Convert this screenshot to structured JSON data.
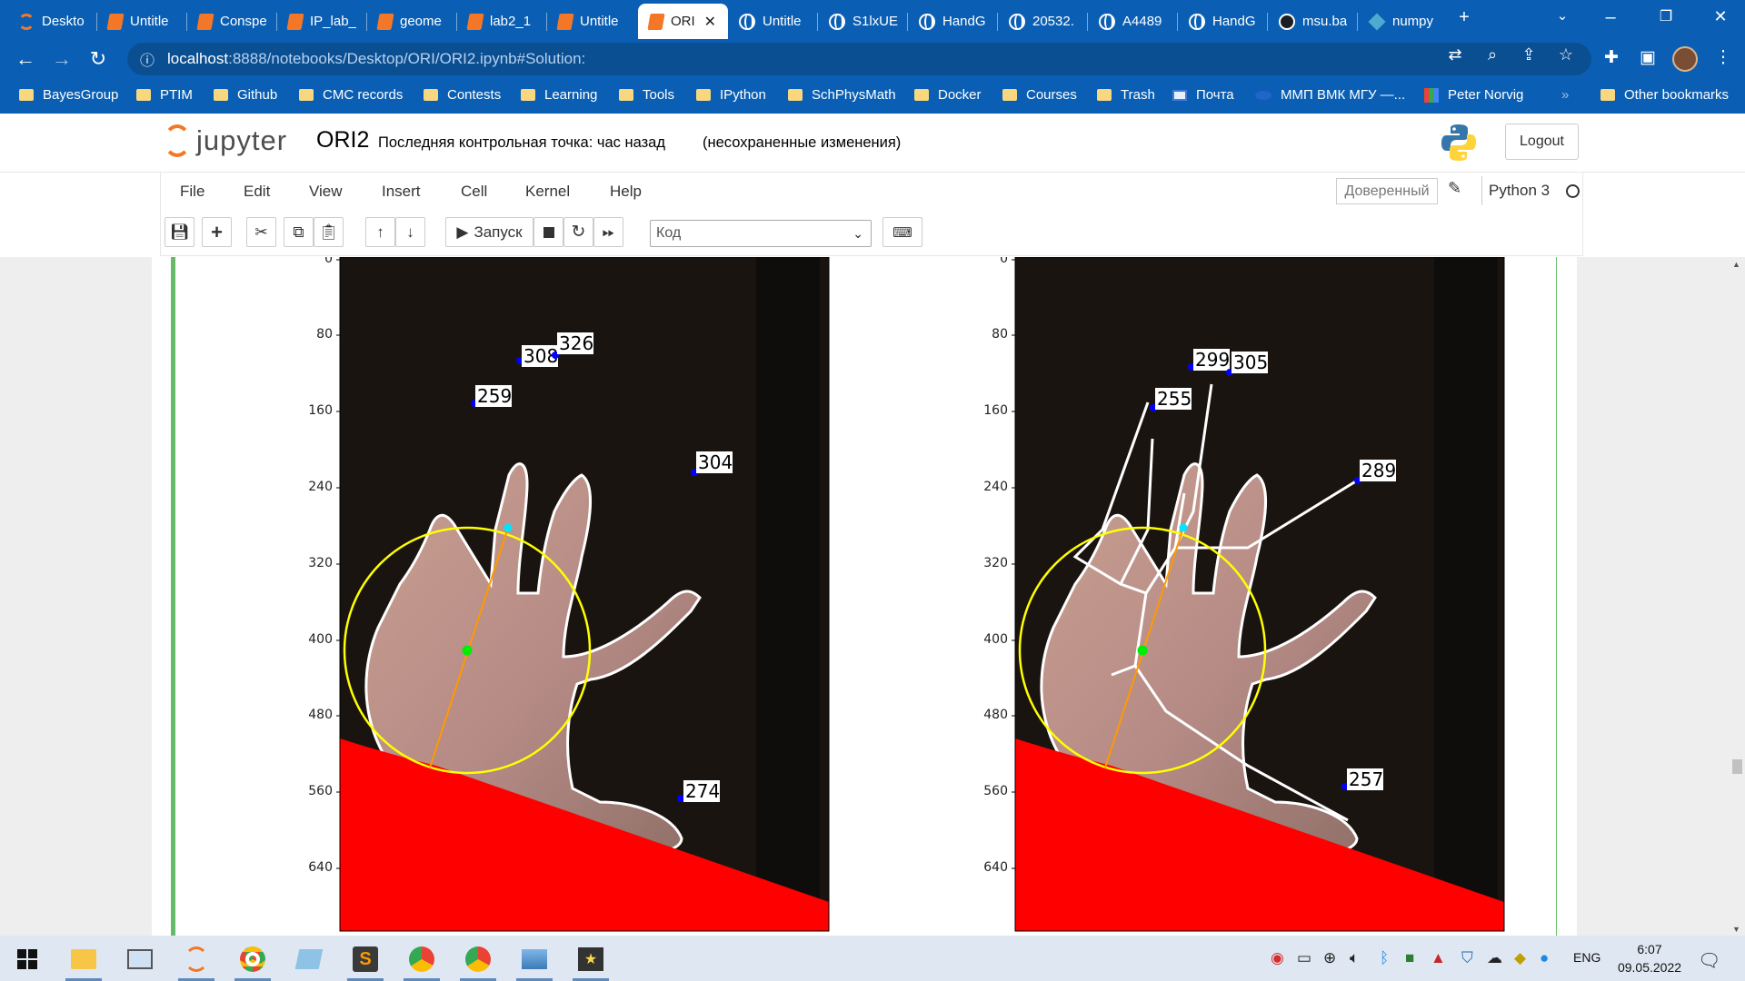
{
  "tabs": [
    {
      "title": "Deskto",
      "icon": "jupyter-icon"
    },
    {
      "title": "Untitle",
      "icon": "notebook-icon"
    },
    {
      "title": "Conspe",
      "icon": "notebook-icon"
    },
    {
      "title": "IP_lab_",
      "icon": "notebook-icon"
    },
    {
      "title": "geome",
      "icon": "notebook-icon"
    },
    {
      "title": "lab2_1",
      "icon": "notebook-icon"
    },
    {
      "title": "Untitle",
      "icon": "notebook-icon"
    },
    {
      "title": "ORI",
      "icon": "notebook-icon",
      "active": true
    },
    {
      "title": "Untitle",
      "icon": "globe-icon"
    },
    {
      "title": "S1lxUE",
      "icon": "globe-icon"
    },
    {
      "title": "HandG",
      "icon": "globe-icon"
    },
    {
      "title": "20532.",
      "icon": "globe-icon"
    },
    {
      "title": "A4489",
      "icon": "globe-icon"
    },
    {
      "title": "HandG",
      "icon": "globe-icon"
    },
    {
      "title": "msu.ba",
      "icon": "github-icon"
    },
    {
      "title": "numpy",
      "icon": "numpy-icon"
    }
  ],
  "address": {
    "host": "localhost",
    "path": ":8888/notebooks/Desktop/ORI/ORI2.ipynb#Solution:"
  },
  "bookmarks": [
    {
      "label": "BayesGroup",
      "icon": "folder-icon"
    },
    {
      "label": "PTIM",
      "icon": "folder-icon"
    },
    {
      "label": "Github",
      "icon": "folder-icon"
    },
    {
      "label": "CMC records",
      "icon": "folder-icon"
    },
    {
      "label": "Contests",
      "icon": "folder-icon"
    },
    {
      "label": "Learning",
      "icon": "folder-icon"
    },
    {
      "label": "Tools",
      "icon": "folder-icon"
    },
    {
      "label": "IPython",
      "icon": "folder-icon"
    },
    {
      "label": "SchPhysMath",
      "icon": "folder-icon"
    },
    {
      "label": "Docker",
      "icon": "folder-icon"
    },
    {
      "label": "Courses",
      "icon": "folder-icon"
    },
    {
      "label": "Trash",
      "icon": "folder-icon"
    },
    {
      "label": "Почта",
      "icon": "mail-icon"
    },
    {
      "label": "ММП ВМК МГУ —...",
      "icon": "site-icon"
    },
    {
      "label": "Peter Norvig",
      "icon": "site-icon"
    }
  ],
  "other_bookmarks": "Other bookmarks",
  "jupyter": {
    "logo_text": "jupyter",
    "notebook_name": "ORI2",
    "checkpoint": "Последняя контрольная точка: час назад",
    "unsaved": "(несохраненные изменения)",
    "logout": "Logout"
  },
  "menu": [
    "File",
    "Edit",
    "View",
    "Insert",
    "Cell",
    "Kernel",
    "Help"
  ],
  "trusted": "Доверенный",
  "kernel": "Python 3",
  "toolbar": {
    "run_label": "Запуск",
    "cell_type": "Код"
  },
  "plots": {
    "y_ticks": [
      "0",
      "80",
      "160",
      "240",
      "320",
      "400",
      "480",
      "560",
      "640"
    ],
    "left_labels": [
      "308",
      "326",
      "259",
      "304",
      "274"
    ],
    "right_labels": [
      "299",
      "305",
      "255",
      "289",
      "257"
    ]
  },
  "clock": {
    "time": "6:07",
    "date": "09.05.2022"
  },
  "lang": "ENG",
  "colors": {
    "chrome_blue": "#0a5fb4",
    "jupyter_orange": "#f37726",
    "cell_green": "#66bb6a",
    "circle_yellow": "#ffff00",
    "red_region": "#ff0000"
  }
}
